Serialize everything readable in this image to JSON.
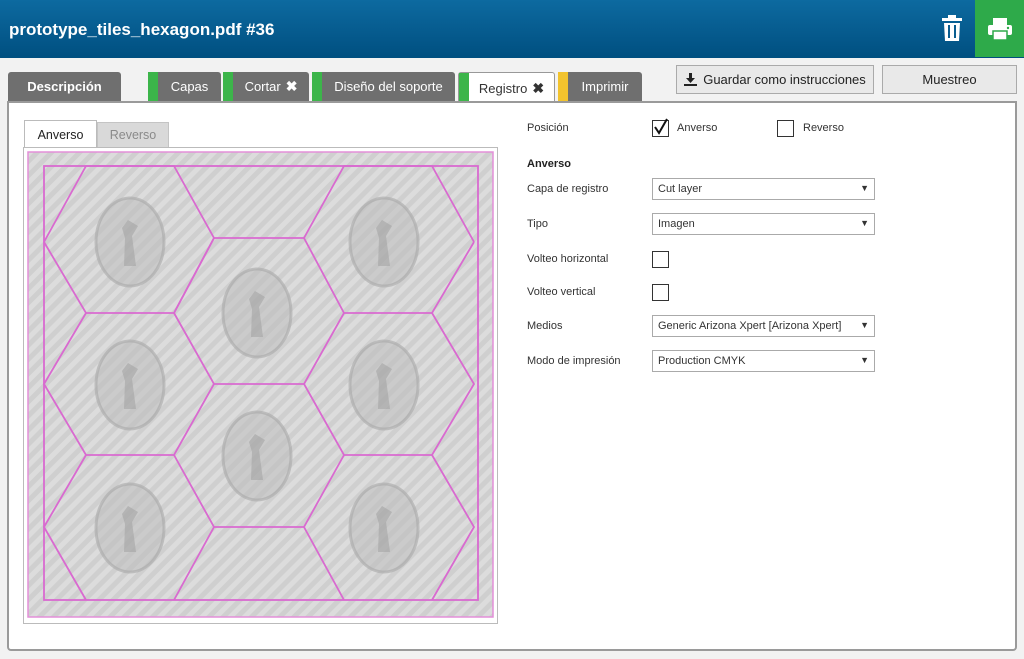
{
  "header": {
    "title": "prototype_tiles_hexagon.pdf #36",
    "trash_icon": "trash-icon",
    "print_icon": "printer-icon",
    "accent": "#2eaa4a"
  },
  "tabs": [
    {
      "label": "Descripción",
      "marker": ""
    },
    {
      "label": "Capas",
      "marker": "#3cb54a"
    },
    {
      "label": "Cortar",
      "marker": "#3cb54a",
      "close": "✖"
    },
    {
      "label": "Diseño del soporte",
      "marker": "#3cb54a"
    },
    {
      "label": "Registro",
      "marker": "#3cb54a",
      "close": "✖"
    },
    {
      "label": "Imprimir",
      "marker": "#f2c32e"
    }
  ],
  "toolbar": {
    "save_label": "Guardar como instrucciones",
    "sample_label": "Muestreo"
  },
  "preview": {
    "tabs": [
      "Anverso",
      "Reverso"
    ]
  },
  "form": {
    "position_label": "Posición",
    "front_label": "Anverso",
    "back_label": "Reverso",
    "front_checked": true,
    "back_checked": false,
    "section_title": "Anverso",
    "reg_layer_label": "Capa de registro",
    "reg_layer_value": "Cut layer",
    "type_label": "Tipo",
    "type_value": "Imagen",
    "hflip_label": "Volteo horizontal",
    "vflip_label": "Volteo vertical",
    "media_label": "Medios",
    "media_value": "Generic Arizona Xpert [Arizona Xpert]",
    "print_mode_label": "Modo de impresión",
    "print_mode_value": "Production CMYK"
  }
}
